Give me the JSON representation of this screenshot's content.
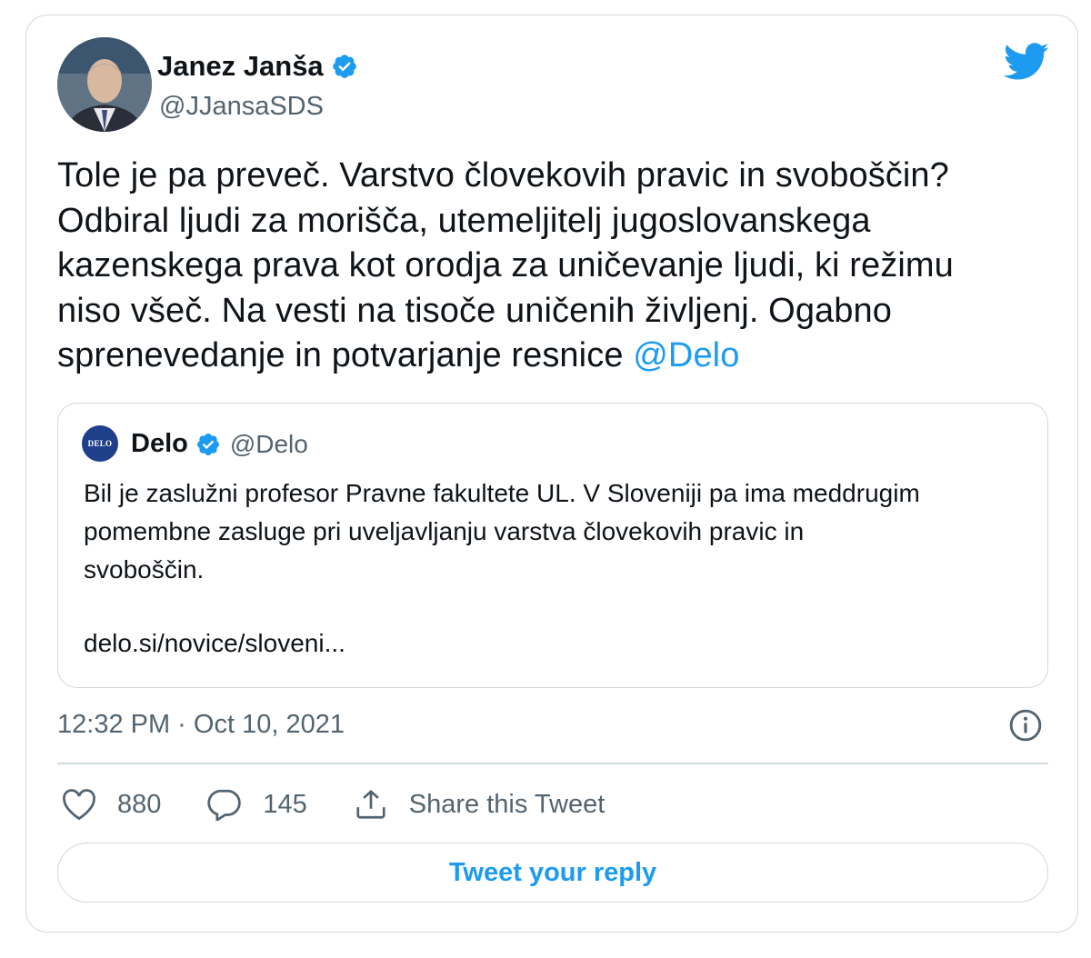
{
  "author": {
    "display_name": "Janez Janša",
    "handle": "@JJansaSDS",
    "verified": true
  },
  "tweet": {
    "lines": [
      "Tole je pa preveč. Varstvo človekovih pravic in svoboščin?",
      "Odbiral ljudi za morišča, utemeljitelj jugoslovanskega",
      "kazenskega prava kot orodja za uničevanje ljudi, ki režimu",
      "niso všeč. Na vesti na tisoče uničenih življenj. Ogabno",
      "sprenevedanje in potvarjanje resnice"
    ],
    "mention": "@Delo"
  },
  "quoted_tweet": {
    "avatar_text": "DELO",
    "display_name": "Delo",
    "handle": "@Delo",
    "verified": true,
    "lines": [
      "Bil je zaslužni profesor Pravne fakultete UL. V Sloveniji pa ima meddrugim",
      "pomembne zasluge pri uveljavljanju varstva človekovih pravic in",
      "svoboščin."
    ],
    "link": "delo.si/novice/sloveni..."
  },
  "meta": {
    "timestamp": "12:32 PM · Oct 10, 2021"
  },
  "actions": {
    "likes": "880",
    "replies": "145",
    "share_label": "Share this Tweet"
  },
  "reply_button_label": "Tweet your reply",
  "colors": {
    "accent": "#1d9bf0",
    "text": "#0f1419",
    "secondary_text": "#536471",
    "border": "#cfd9de"
  },
  "icons": [
    "verified-badge-icon",
    "twitter-bird-icon",
    "info-icon",
    "heart-icon",
    "reply-bubble-icon",
    "share-icon"
  ]
}
